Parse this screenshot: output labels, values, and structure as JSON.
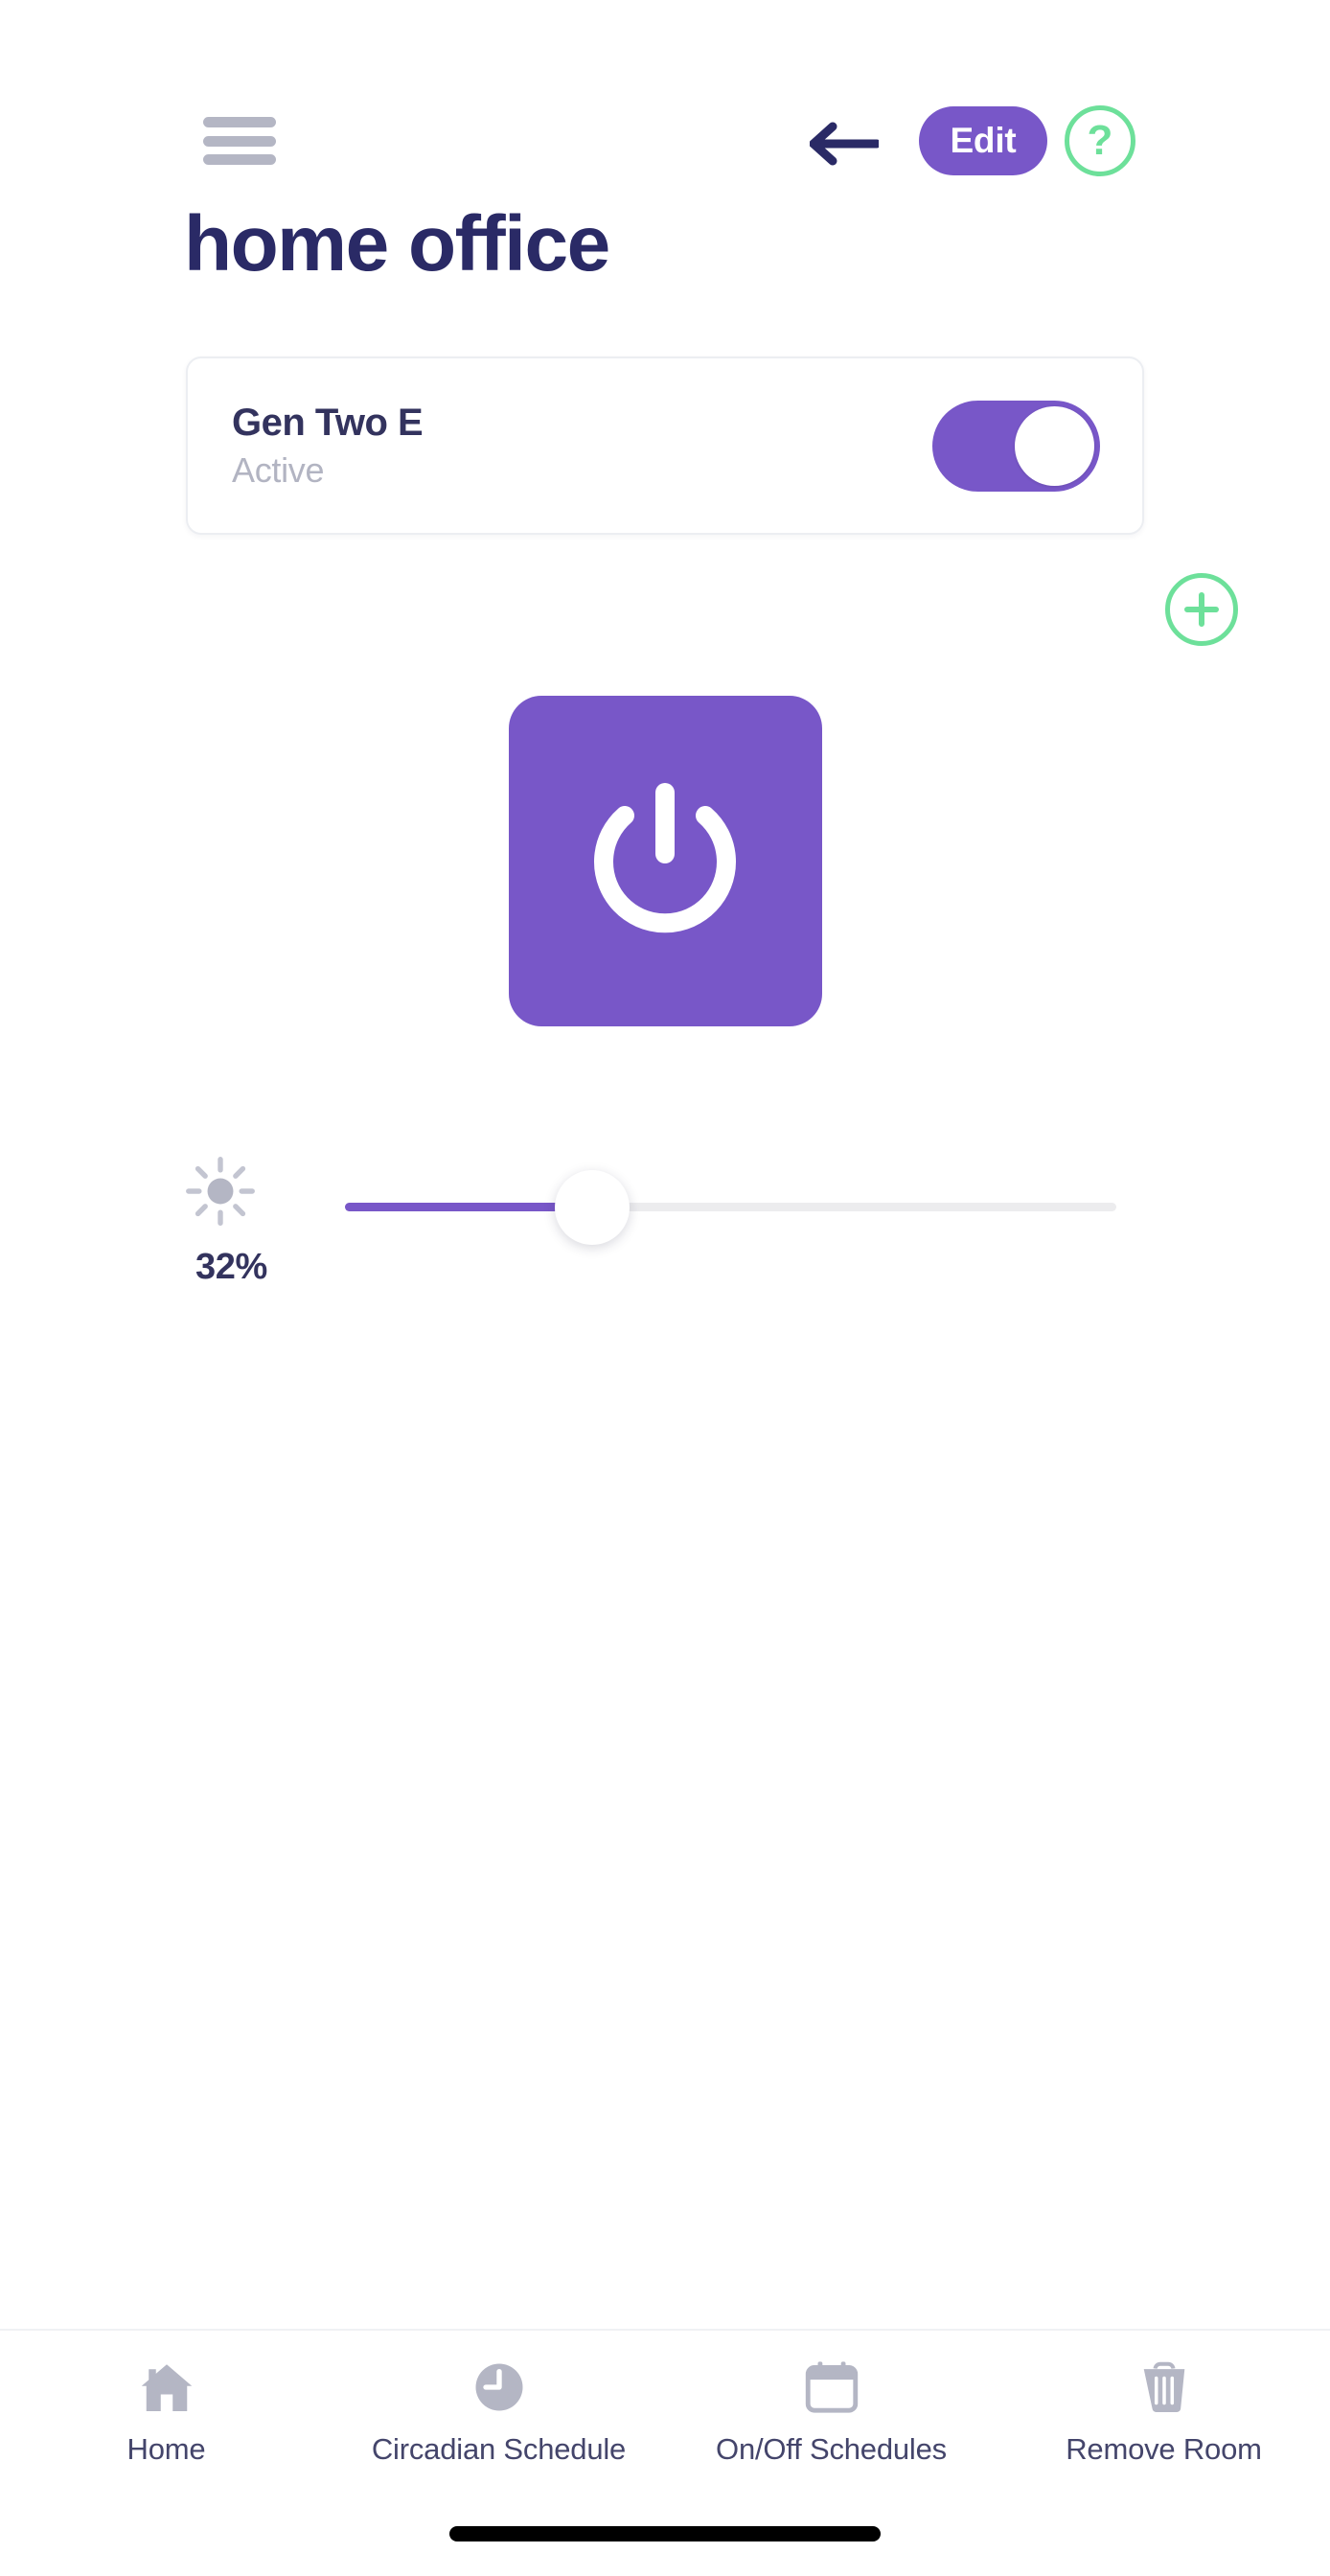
{
  "header": {
    "menu_icon": "hamburger-menu-icon",
    "back_icon": "back-arrow-icon",
    "edit_label": "Edit",
    "help_label": "?",
    "help_icon": "question-mark-icon"
  },
  "page_title": "home office",
  "device_card": {
    "name": "Gen Two E",
    "status": "Active",
    "toggle_on": true
  },
  "add_button": {
    "icon": "plus-circle-icon"
  },
  "power_button": {
    "icon": "power-icon",
    "state": "on"
  },
  "brightness": {
    "icon": "brightness-sun-icon",
    "value_label": "32%",
    "value": 32,
    "min": 0,
    "max": 100
  },
  "bottom_nav": {
    "items": [
      {
        "label": "Home",
        "icon": "home-icon"
      },
      {
        "label": "Circadian Schedule",
        "icon": "clock-icon"
      },
      {
        "label": "On/Off Schedules",
        "icon": "calendar-icon"
      },
      {
        "label": "Remove Room",
        "icon": "trash-icon"
      }
    ]
  },
  "colors": {
    "purple": "#7857c8",
    "navy": "#2a2a66",
    "green": "#6de09a",
    "gray": "#b4b6c4",
    "track": "#ececee"
  }
}
